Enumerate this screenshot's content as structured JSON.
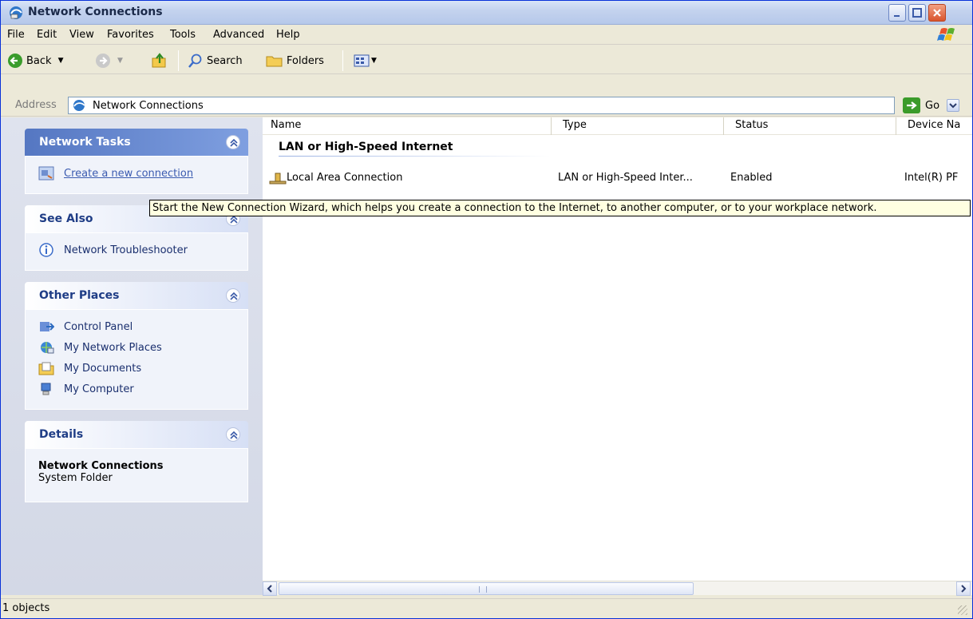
{
  "window": {
    "title": "Network Connections",
    "controls": {
      "minimize": "minimize",
      "maximize": "maximize",
      "close": "close"
    }
  },
  "menu": [
    "File",
    "Edit",
    "View",
    "Favorites",
    "Tools",
    "Advanced",
    "Help"
  ],
  "toolbar": {
    "back_label": "Back",
    "search_label": "Search",
    "folders_label": "Folders"
  },
  "address": {
    "label": "Address",
    "value": "Network Connections",
    "go_label": "Go"
  },
  "taskpane": {
    "network_tasks": {
      "title": "Network Tasks",
      "items": [
        "Create a new connection"
      ]
    },
    "see_also": {
      "title": "See Also",
      "items": [
        "Network Troubleshooter"
      ]
    },
    "other_places": {
      "title": "Other Places",
      "items": [
        "Control Panel",
        "My Network Places",
        "My Documents",
        "My Computer"
      ]
    },
    "details": {
      "title": "Details",
      "name": "Network Connections",
      "type": "System Folder"
    }
  },
  "content": {
    "columns": [
      "Name",
      "Type",
      "Status",
      "Device Na"
    ],
    "group": "LAN or High-Speed Internet",
    "rows": [
      {
        "name": "Local Area Connection",
        "type": "LAN or High-Speed Inter...",
        "status": "Enabled",
        "device": "Intel(R) PF"
      }
    ]
  },
  "tooltip": "Start the New Connection Wizard, which helps you create a connection to the Internet, to another computer, or to your workplace network.",
  "status": "1 objects",
  "colors": {
    "task_header_blue": "#5577c2",
    "link_blue": "#3b5bb0",
    "tooltip_bg": "#ffffe1"
  }
}
